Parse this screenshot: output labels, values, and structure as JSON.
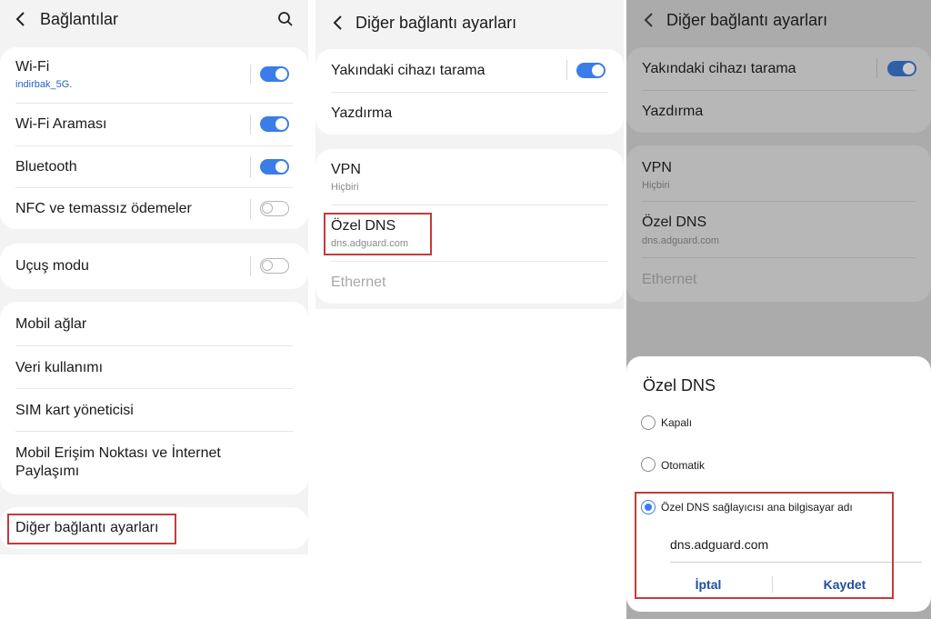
{
  "screen1": {
    "title": "Bağlantılar",
    "icons": {
      "back": "back-arrow-icon",
      "search": "search-icon"
    },
    "wifi": {
      "label": "Wi-Fi",
      "network": "indirbak_5G.",
      "enabled": true
    },
    "wifi_calling": {
      "label": "Wi-Fi Araması",
      "enabled": true
    },
    "bluetooth": {
      "label": "Bluetooth",
      "enabled": true
    },
    "nfc": {
      "label": "NFC ve temassız ödemeler",
      "enabled": false
    },
    "airplane": {
      "label": "Uçuş modu",
      "enabled": false
    },
    "mobile_networks": "Mobil ağlar",
    "data_usage": "Veri kullanımı",
    "sim_manager": "SIM kart yöneticisi",
    "hotspot_line1": "Mobil Erişim Noktası ve İnternet",
    "hotspot_line2": "Paylaşımı",
    "more_settings": "Diğer bağlantı ayarları"
  },
  "screen2": {
    "title": "Diğer bağlantı ayarları",
    "nearby_scan": {
      "label": "Yakındaki cihazı tarama",
      "enabled": true
    },
    "printing": "Yazdırma",
    "vpn": {
      "label": "VPN",
      "value": "Hiçbiri"
    },
    "private_dns": {
      "label": "Özel DNS",
      "value": "dns.adguard.com"
    },
    "ethernet": "Ethernet"
  },
  "screen3": {
    "title": "Diğer bağlantı ayarları",
    "nearby_scan": {
      "label": "Yakındaki cihazı tarama",
      "enabled": true
    },
    "printing": "Yazdırma",
    "vpn": {
      "label": "VPN",
      "value": "Hiçbiri"
    },
    "private_dns": {
      "label": "Özel DNS",
      "value": "dns.adguard.com"
    },
    "ethernet": "Ethernet",
    "dialog": {
      "title": "Özel DNS",
      "options": [
        "Kapalı",
        "Otomatik",
        "Özel DNS sağlayıcısı ana bilgisayar adı"
      ],
      "selected_index": 2,
      "hostname": "dns.adguard.com",
      "cancel": "İptal",
      "save": "Kaydet"
    }
  },
  "colors": {
    "accent": "#3a7de8",
    "highlight_box": "#c43a3a",
    "dialog_button": "#1f4f9c"
  }
}
